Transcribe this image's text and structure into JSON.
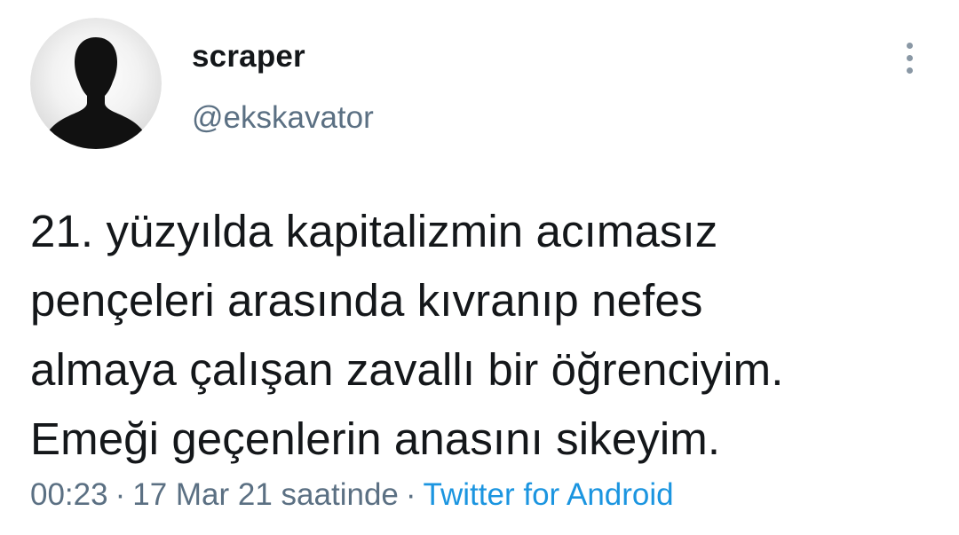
{
  "user": {
    "display_name": "scraper",
    "handle": "@ekskavator",
    "avatar_icon": "default-silhouette-avatar-icon"
  },
  "more_icon": "vertical-ellipsis-icon",
  "tweet": {
    "text": "21. yüzyılda kapitalizmin acımasız\npençeleri arasında kıvranıp nefes\nalmaya çalışan zavallı bir öğrenciyim.\nEmeği geçenlerin anasını sikeyim."
  },
  "meta": {
    "time": "00:23",
    "separator": "·",
    "date": "17 Mar 21 saatinde",
    "source": "Twitter for Android"
  },
  "colors": {
    "text": "#14171a",
    "secondary": "#5b7083",
    "link": "#1b95e0"
  }
}
